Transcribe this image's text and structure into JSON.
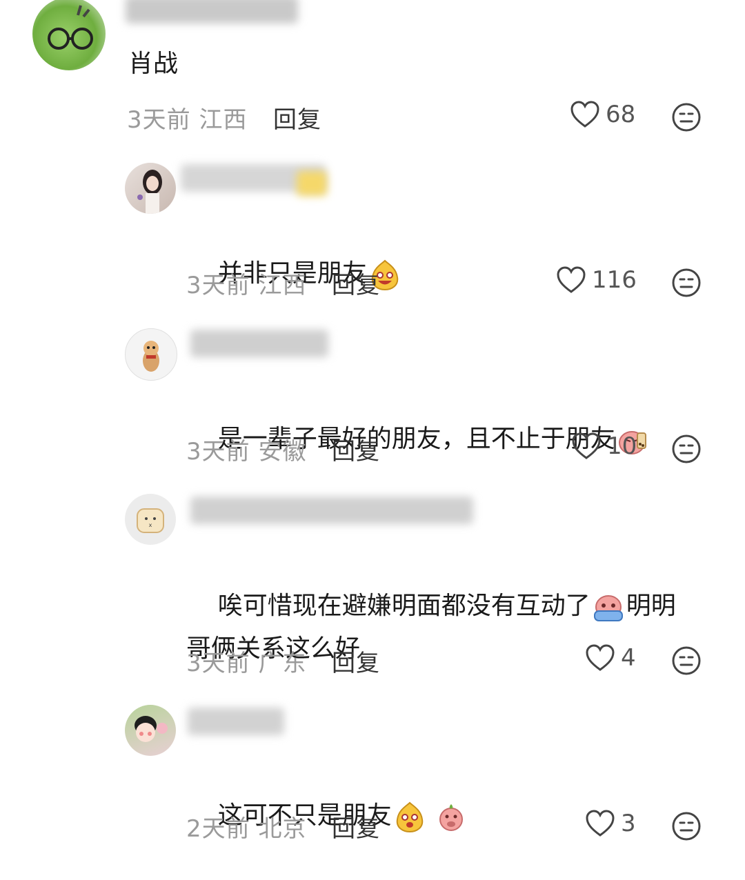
{
  "comments": [
    {
      "body": "肖战",
      "time_location": "3天前 江西",
      "reply_label": "回复",
      "likes": "68"
    },
    {
      "body": "并非只是朋友",
      "time_location": "3天前 江西",
      "reply_label": "回复",
      "likes": "116"
    },
    {
      "body": "是一辈子最好的朋友，且不止于朋友",
      "time_location": "3天前 安徽",
      "reply_label": "回复",
      "likes": "10"
    },
    {
      "body_line1": "唉可惜现在避嫌明面都没有互动了",
      "body_line1b": "明明",
      "body_line2": "哥俩关系这么好",
      "time_location": "3天前 广东",
      "reply_label": "回复",
      "likes": "4"
    },
    {
      "body": "这可不只是朋友",
      "time_location": "2天前 北京",
      "reply_label": "回复",
      "likes": "3"
    }
  ],
  "icons": {
    "like": "heart-outline-icon",
    "dislike": "neutral-face-icon"
  },
  "colors": {
    "meta": "#9a9a9a",
    "text": "#1a1a1a"
  }
}
